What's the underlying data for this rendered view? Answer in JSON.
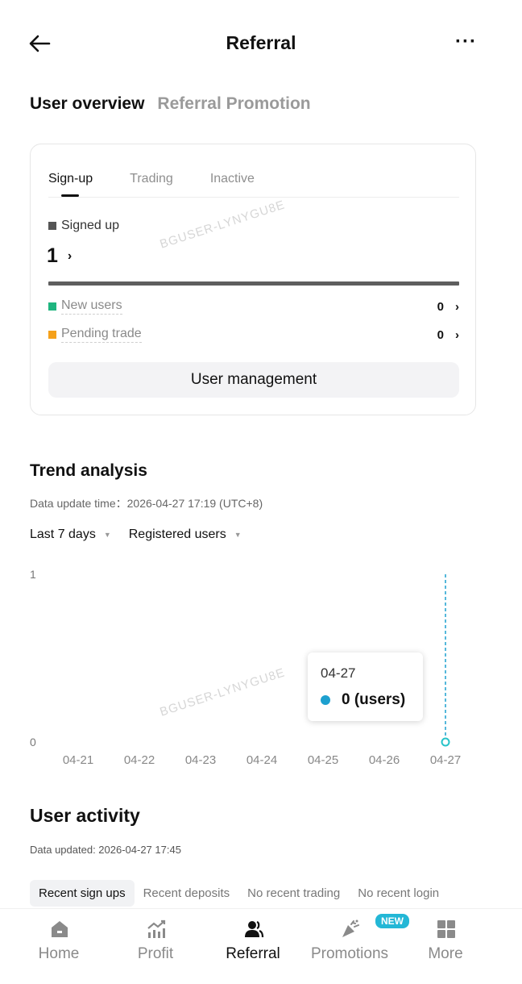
{
  "header": {
    "title": "Referral",
    "more_label": "···"
  },
  "main_tabs": [
    {
      "label": "User overview",
      "active": true
    },
    {
      "label": "Referral Promotion",
      "active": false
    }
  ],
  "overview": {
    "sub_tabs": [
      {
        "label": "Sign-up",
        "active": true
      },
      {
        "label": "Trading",
        "active": false
      },
      {
        "label": "Inactive",
        "active": false
      }
    ],
    "signed_up_label": "Signed up",
    "signed_up_count": "1",
    "rows": [
      {
        "label": "New users",
        "value": "0",
        "color": "#1fb57f"
      },
      {
        "label": "Pending trade",
        "value": "0",
        "color": "#f5a11b"
      }
    ],
    "user_management_label": "User management"
  },
  "watermark": "BGUSER-LYNYGU8E",
  "trend": {
    "title": "Trend analysis",
    "update_time": "Data update time：2026-04-27 17:19 (UTC+8)",
    "range_filter": "Last 7 days",
    "metric_filter": "Registered users",
    "tooltip": {
      "date": "04-27",
      "value": "0 (users)"
    }
  },
  "chart_data": {
    "type": "line",
    "categories": [
      "04-21",
      "04-22",
      "04-23",
      "04-24",
      "04-25",
      "04-26",
      "04-27"
    ],
    "series": [
      {
        "values": [
          null,
          null,
          null,
          null,
          null,
          null,
          0
        ],
        "color": "#1da0cf"
      }
    ],
    "ylim": [
      0,
      1
    ],
    "y_ticks": [
      "0",
      "1"
    ],
    "highlighted_index": 6,
    "grid": false
  },
  "activity": {
    "title": "User activity",
    "update_time": "Data updated: 2026-04-27 17:45",
    "tabs": [
      "Recent sign ups",
      "Recent deposits",
      "No recent trading",
      "No recent login"
    ]
  },
  "nav": {
    "items": [
      {
        "label": "Home",
        "icon": "home-icon",
        "active": false
      },
      {
        "label": "Profit",
        "icon": "profit-chart-icon",
        "active": false
      },
      {
        "label": "Referral",
        "icon": "users-icon",
        "active": true
      },
      {
        "label": "Promotions",
        "icon": "megaphone-icon",
        "active": false
      },
      {
        "label": "More",
        "icon": "grid-icon",
        "active": false
      }
    ],
    "new_badge": "NEW"
  },
  "colors": {
    "accent": "#1da0cf",
    "green": "#1fb57f",
    "orange": "#f5a11b"
  }
}
